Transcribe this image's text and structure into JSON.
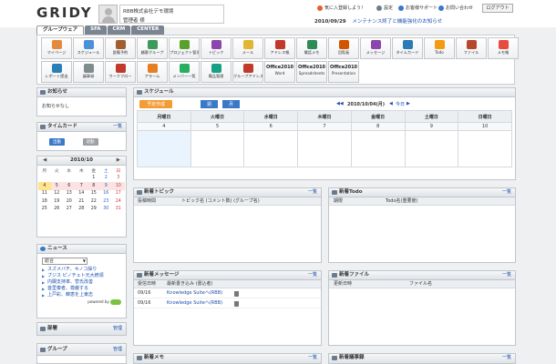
{
  "header": {
    "logo": "GRIDY",
    "company": "RBB株式会社デモ環境",
    "user": "管理者 様",
    "links": [
      {
        "label": "気に入登録しよう！",
        "color": "#e2622b"
      },
      {
        "label": "設定",
        "color": "#6b7d8f"
      },
      {
        "label": "お客様サポート",
        "color": "#3a78c8"
      },
      {
        "label": "お問い合わせ",
        "color": "#3a78c8"
      }
    ],
    "logout": "ログアウト",
    "date": "2010/09/29",
    "notice": "メンテナンス終了と機能強化のお知らせ"
  },
  "tabs": [
    "グループウェア",
    "SFA",
    "CRM",
    "CENTER"
  ],
  "apps_row1": [
    {
      "label": "マイページ",
      "color": "#e58a3c"
    },
    {
      "label": "スケジュール",
      "color": "#4a90d9"
    },
    {
      "label": "設備予約",
      "color": "#a35d2e"
    },
    {
      "label": "顧客グループ",
      "color": "#3c9b5a"
    },
    {
      "label": "プロジェクト管理",
      "color": "#5aa02c"
    },
    {
      "label": "トピック",
      "color": "#8e44ad"
    },
    {
      "label": "メール",
      "color": "#e2b632"
    },
    {
      "label": "アドレス帳",
      "color": "#c0392b"
    },
    {
      "label": "電話メモ",
      "color": "#2e8b57"
    },
    {
      "label": "回覧板",
      "color": "#d35400"
    },
    {
      "label": "メッセージ",
      "color": "#8e44ad"
    },
    {
      "label": "タイムカード",
      "color": "#2c7bb6"
    },
    {
      "label": "Todo",
      "color": "#f39c12"
    },
    {
      "label": "ファイル",
      "color": "#b7482b"
    },
    {
      "label": "メモ帳",
      "color": "#e74c3c"
    }
  ],
  "apps_row2": [
    {
      "label": "レポート提出",
      "color": "#2980b9"
    },
    {
      "label": "議事録",
      "color": "#7f8c8d"
    },
    {
      "label": "ワークフロー",
      "color": "#c0392b"
    },
    {
      "label": "アラーム",
      "color": "#e67e22"
    },
    {
      "label": "メンバー一覧",
      "color": "#27ae60"
    },
    {
      "label": "備品管理",
      "color": "#16a085"
    },
    {
      "label": "グループアドレス帳",
      "color": "#c0392b"
    },
    {
      "label": "Word",
      "office": true
    },
    {
      "label": "Spreadsheets",
      "office": true
    },
    {
      "label": "Presentation",
      "office": true
    }
  ],
  "office_label": "Office2010",
  "sidebar": {
    "notice": {
      "title": "お知らせ",
      "body": "お知らせなし"
    },
    "timecard": {
      "title": "タイムカード",
      "more": "一覧",
      "in": "出勤",
      "out": "退勤"
    },
    "calendar": {
      "title": "2010/10",
      "days": [
        "月",
        "火",
        "水",
        "木",
        "金",
        "土",
        "日"
      ]
    },
    "news": {
      "title": "ニュース",
      "select": "総合",
      "items": [
        "スズメバチ、キノコ採り",
        "ブジス ピノチェト元大統領",
        "内閣支持率、菅氏改善",
        "首里奏者、尊厳する",
        "上戸彩、韓恵を上東志"
      ],
      "powered": "powered by"
    },
    "dept": {
      "title": "部署",
      "more": "管理"
    },
    "group": {
      "title": "グループ",
      "more": "管理"
    }
  },
  "schedule": {
    "title": "スケジュール",
    "register": "予定作成",
    "view_week": "週",
    "view_month": "月",
    "range": "2010/10/04(月)",
    "today": "今日",
    "days": [
      "月曜日",
      "火曜日",
      "水曜日",
      "木曜日",
      "金曜日",
      "土曜日",
      "日曜日"
    ],
    "dates": [
      "4",
      "5",
      "6",
      "7",
      "8",
      "9",
      "10"
    ]
  },
  "topic": {
    "title": "新着トピック",
    "more": "一覧",
    "col1": "投稿時間",
    "col2": "トピック名 (コメント数) (グループ名)"
  },
  "todo": {
    "title": "新着Todo",
    "more": "一覧",
    "col1": "期限",
    "col2": "Todo名(重要度)"
  },
  "message": {
    "title": "新着メッセージ",
    "more": "一覧",
    "col1": "受信日時",
    "col2": "最新書き込み (書込者)",
    "rows": [
      {
        "date": "09/16",
        "text": "Knowledge Suiteへ(RBB)"
      },
      {
        "date": "09/16",
        "text": "Knowledge Suiteへ(RBB)"
      }
    ]
  },
  "file": {
    "title": "新着ファイル",
    "more": "一覧",
    "col1": "更新日時",
    "col2": "ファイル名"
  },
  "memo": {
    "title": "新着メモ",
    "more": "一覧"
  },
  "minutes": {
    "title": "新着議事録",
    "more": "一覧"
  }
}
